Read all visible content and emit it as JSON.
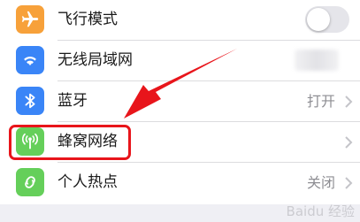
{
  "settings": {
    "items": [
      {
        "label": "飞行模式",
        "icon": "airplane-icon",
        "color": "#f7a13a",
        "control": "toggle",
        "toggle_on": false
      },
      {
        "label": "无线局域网",
        "icon": "wifi-icon",
        "color": "#3a85f7",
        "control": "blurred-value"
      },
      {
        "label": "蓝牙",
        "icon": "bluetooth-icon",
        "color": "#3a85f7",
        "control": "value",
        "value": "打开"
      },
      {
        "label": "蜂窝网络",
        "icon": "cellular-antenna-icon",
        "color": "#65cf5a",
        "control": "chevron"
      },
      {
        "label": "个人热点",
        "icon": "personal-hotspot-icon",
        "color": "#65cf5a",
        "control": "value",
        "value": "关闭"
      }
    ]
  },
  "annotation": {
    "highlight_color": "#e8151b",
    "arrow_color": "#e8151b"
  },
  "watermark": {
    "text": "Baidu 经验"
  }
}
